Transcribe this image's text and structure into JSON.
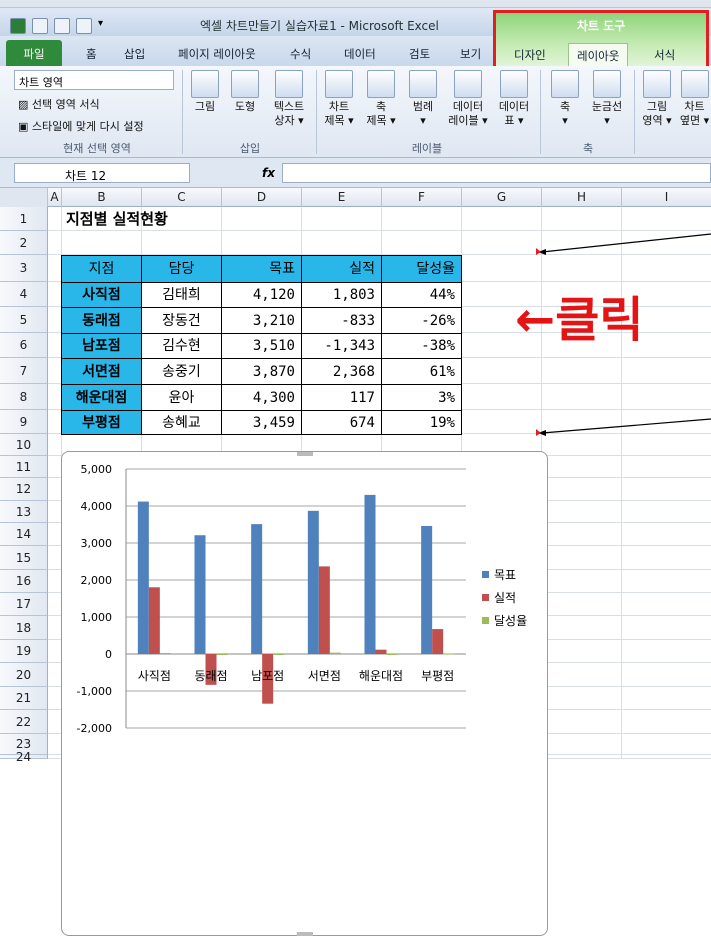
{
  "app": {
    "window_title": "엑셀 차트만들기 실습자료1 - Microsoft Excel",
    "chart_tools_label": "차트 도구"
  },
  "tabs": [
    "파일",
    "홈",
    "삽입",
    "페이지 레이아웃",
    "수식",
    "데이터",
    "검토",
    "보기"
  ],
  "chart_tabs": [
    "디자인",
    "레이아웃",
    "서식"
  ],
  "ribbon": {
    "selection_value": "차트 영역",
    "format_selection": "선택 영역 서식",
    "reset_style": "스타일에 맞게 다시 설정",
    "group_current": "현재 선택 영역",
    "group_insert": "삽입",
    "group_labels": "레이블",
    "group_axes": "축",
    "buttons": {
      "picture": "그림",
      "shapes": "도형",
      "textbox": "텍스트\n상자 ▾",
      "chart_title": "차트\n제목 ▾",
      "axis_titles": "축\n제목 ▾",
      "legend": "범례\n▾",
      "data_labels": "데이터\n레이블 ▾",
      "data_table": "데이터\n표 ▾",
      "axes": "축\n▾",
      "gridlines": "눈금선\n▾",
      "plot_area": "그림\n영역 ▾",
      "chart_wall": "차트\n옆면 ▾"
    }
  },
  "formula_bar": {
    "name_box": "차트 12",
    "fx": "fx",
    "formula": ""
  },
  "sheet": {
    "columns": [
      "A",
      "B",
      "C",
      "D",
      "E",
      "F",
      "G",
      "H",
      "I"
    ],
    "rows": [
      "1",
      "2",
      "3",
      "4",
      "5",
      "6",
      "7",
      "8",
      "9",
      "10",
      "11",
      "12",
      "13",
      "14",
      "15",
      "16",
      "17",
      "18",
      "19",
      "20",
      "21",
      "22",
      "23",
      "24"
    ],
    "title": "지점별 실적현황",
    "table_headers": [
      "지점",
      "담당",
      "목표",
      "실적",
      "달성율"
    ],
    "table_rows": [
      [
        "사직점",
        "김태희",
        "4,120",
        "1,803",
        "44%"
      ],
      [
        "동래점",
        "장동건",
        "3,210",
        "-833",
        "-26%"
      ],
      [
        "남포점",
        "김수현",
        "3,510",
        "-1,343",
        "-38%"
      ],
      [
        "서면점",
        "송중기",
        "3,870",
        "2,368",
        "61%"
      ],
      [
        "해운대점",
        "윤아",
        "4,300",
        "117",
        "3%"
      ],
      [
        "부평점",
        "송혜교",
        "3,459",
        "674",
        "19%"
      ]
    ]
  },
  "annotation": {
    "click_label": "←클릭"
  },
  "chart_data": {
    "type": "bar",
    "categories": [
      "사직점",
      "동래점",
      "남포점",
      "서면점",
      "해운대점",
      "부평점"
    ],
    "series": [
      {
        "name": "목표",
        "values": [
          4120,
          3210,
          3510,
          3870,
          4300,
          3459
        ],
        "color": "#4f81bd"
      },
      {
        "name": "실적",
        "values": [
          1803,
          -833,
          -1343,
          2368,
          117,
          674
        ],
        "color": "#c0504d"
      },
      {
        "name": "달성율",
        "values": [
          0.44,
          -0.26,
          -0.38,
          0.61,
          0.03,
          0.19
        ],
        "color": "#9bbb59"
      }
    ],
    "ylim": [
      -2000,
      5000
    ],
    "yticks": [
      "5,000",
      "4,000",
      "3,000",
      "2,000",
      "1,000",
      "0",
      "-1,000",
      "-2,000"
    ],
    "legend": "right",
    "grid": true
  }
}
